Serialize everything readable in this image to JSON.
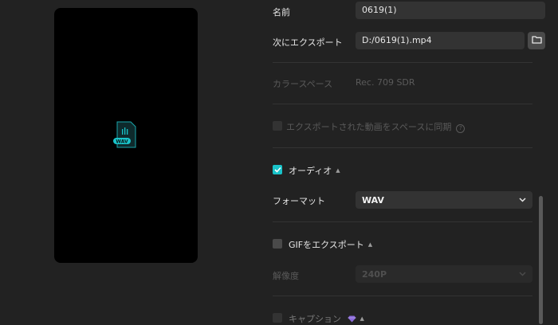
{
  "preview": {
    "file_badge": "WAV"
  },
  "name": {
    "label": "名前",
    "value": "0619(1)"
  },
  "export_to": {
    "label": "次にエクスポート",
    "value": "D:/0619(1).mp4"
  },
  "color_space": {
    "label": "カラースペース",
    "value": "Rec. 709 SDR"
  },
  "export_to_space": {
    "label": "エクスポートされた動画をスペースに同期",
    "help": "?"
  },
  "audio": {
    "label": "オーディオ",
    "caret": "▲",
    "format_label": "フォーマット",
    "format_value": "WAV"
  },
  "gif": {
    "label": "GIFをエクスポート",
    "caret": "▲",
    "resolution_label": "解像度",
    "resolution_value": "240P"
  },
  "caption": {
    "label": "キャプション",
    "caret": "▲"
  },
  "colors": {
    "accent": "#19c3c9",
    "premium": "#8a6ad8"
  }
}
